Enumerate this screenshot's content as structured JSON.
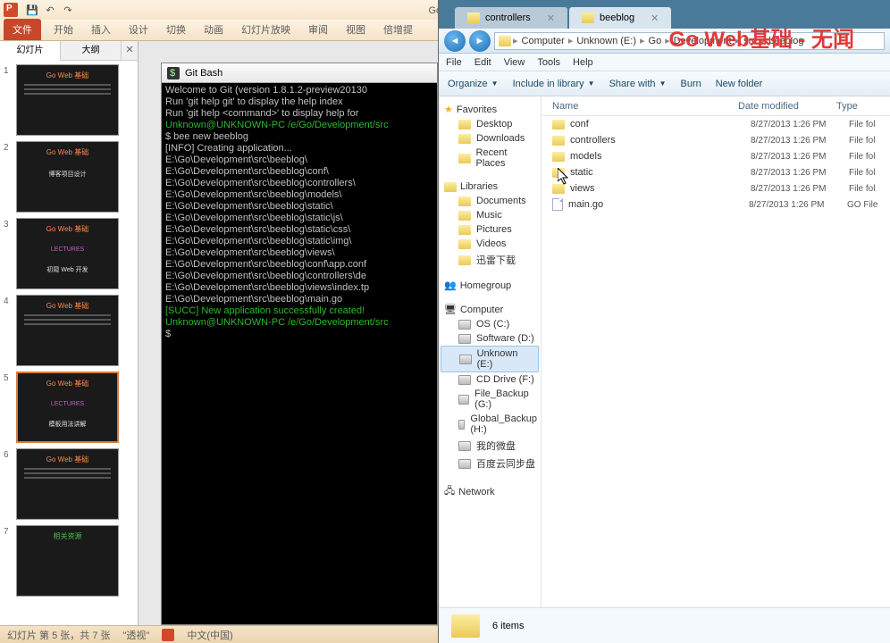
{
  "watermark": "Go Web基础 - 无闻",
  "ppt": {
    "title": "Go Web基础-课堂讲义.p",
    "ribbon": {
      "file": "文件",
      "tabs": [
        "开始",
        "插入",
        "设计",
        "切换",
        "动画",
        "幻灯片放映",
        "审阅",
        "视图",
        "倍增提"
      ]
    },
    "panel": {
      "tab_slides": "幻灯片",
      "tab_outline": "大纲"
    },
    "thumbs": [
      {
        "n": "1",
        "title": "Go Web 基础",
        "sub": ""
      },
      {
        "n": "2",
        "title": "Go Web 基础",
        "sub": "博客项目设计"
      },
      {
        "n": "3",
        "title": "Go Web 基础",
        "sub": "初窥 Web 开发",
        "subClass": "thumb-sub",
        "pre": "LECTURES"
      },
      {
        "n": "4",
        "title": "Go Web 基础",
        "sub": ""
      },
      {
        "n": "5",
        "title": "Go Web 基础",
        "sub": "模板用法讲解",
        "pre": "LECTURES"
      },
      {
        "n": "6",
        "title": "Go Web 基础",
        "sub": ""
      },
      {
        "n": "7",
        "title": "相关资源",
        "sub": "",
        "green": true
      }
    ],
    "status": {
      "slide": "幻灯片 第 5 张，共 7 张",
      "theme": "\"透视\"",
      "lang": "中文(中国)"
    }
  },
  "gitbash": {
    "title": "Git Bash",
    "lines": [
      {
        "t": "Welcome to Git (version 1.8.1.2-preview20130"
      },
      {
        "t": ""
      },
      {
        "t": "Run 'git help git' to display the help index"
      },
      {
        "t": "Run 'git help <command>' to display help for"
      },
      {
        "t": "Unknown@UNKNOWN-PC /e/Go/Development/src",
        "c": "gb-green"
      },
      {
        "t": "$ bee new beeblog"
      },
      {
        "t": "[INFO] Creating application..."
      },
      {
        "t": "E:\\Go\\Development\\src\\beeblog\\"
      },
      {
        "t": "E:\\Go\\Development\\src\\beeblog\\conf\\"
      },
      {
        "t": "E:\\Go\\Development\\src\\beeblog\\controllers\\"
      },
      {
        "t": "E:\\Go\\Development\\src\\beeblog\\models\\"
      },
      {
        "t": "E:\\Go\\Development\\src\\beeblog\\static\\"
      },
      {
        "t": "E:\\Go\\Development\\src\\beeblog\\static\\js\\"
      },
      {
        "t": "E:\\Go\\Development\\src\\beeblog\\static\\css\\"
      },
      {
        "t": "E:\\Go\\Development\\src\\beeblog\\static\\img\\"
      },
      {
        "t": "E:\\Go\\Development\\src\\beeblog\\views\\"
      },
      {
        "t": "E:\\Go\\Development\\src\\beeblog\\conf\\app.conf"
      },
      {
        "t": "E:\\Go\\Development\\src\\beeblog\\controllers\\de"
      },
      {
        "t": "E:\\Go\\Development\\src\\beeblog\\views\\index.tp"
      },
      {
        "t": "E:\\Go\\Development\\src\\beeblog\\main.go"
      },
      {
        "t": "[SUCC] New application successfully created!",
        "c": "gb-green"
      },
      {
        "t": "Unknown@UNKNOWN-PC /e/Go/Development/src",
        "c": "gb-green"
      },
      {
        "t": "$"
      }
    ]
  },
  "explorer": {
    "tabs": [
      {
        "label": "controllers"
      },
      {
        "label": "beeblog"
      }
    ],
    "breadcrumb": [
      "Computer",
      "Unknown (E:)",
      "Go",
      "Development",
      "src",
      "beeblog"
    ],
    "menu": [
      "File",
      "Edit",
      "View",
      "Tools",
      "Help"
    ],
    "toolbar": {
      "organize": "Organize",
      "include": "Include in library",
      "share": "Share with",
      "burn": "Burn",
      "newfolder": "New folder"
    },
    "nav": {
      "favorites": {
        "head": "Favorites",
        "items": [
          "Desktop",
          "Downloads",
          "Recent Places"
        ]
      },
      "libraries": {
        "head": "Libraries",
        "items": [
          "Documents",
          "Music",
          "Pictures",
          "Videos",
          "迅雷下载"
        ]
      },
      "homegroup": "Homegroup",
      "computer": {
        "head": "Computer",
        "items": [
          "OS (C:)",
          "Software (D:)",
          "Unknown (E:)",
          "CD Drive (F:)",
          "File_Backup (G:)",
          "Global_Backup (H:)",
          "我的微盘",
          "百度云同步盘"
        ]
      },
      "network": "Network"
    },
    "cols": {
      "name": "Name",
      "date": "Date modified",
      "type": "Type"
    },
    "files": [
      {
        "name": "conf",
        "date": "8/27/2013 1:26 PM",
        "type": "File fol",
        "f": true
      },
      {
        "name": "controllers",
        "date": "8/27/2013 1:26 PM",
        "type": "File fol",
        "f": true
      },
      {
        "name": "models",
        "date": "8/27/2013 1:26 PM",
        "type": "File fol",
        "f": true
      },
      {
        "name": "static",
        "date": "8/27/2013 1:26 PM",
        "type": "File fol",
        "f": true
      },
      {
        "name": "views",
        "date": "8/27/2013 1:26 PM",
        "type": "File fol",
        "f": true
      },
      {
        "name": "main.go",
        "date": "8/27/2013 1:26 PM",
        "type": "GO File",
        "f": false
      }
    ],
    "status": "6 items"
  }
}
